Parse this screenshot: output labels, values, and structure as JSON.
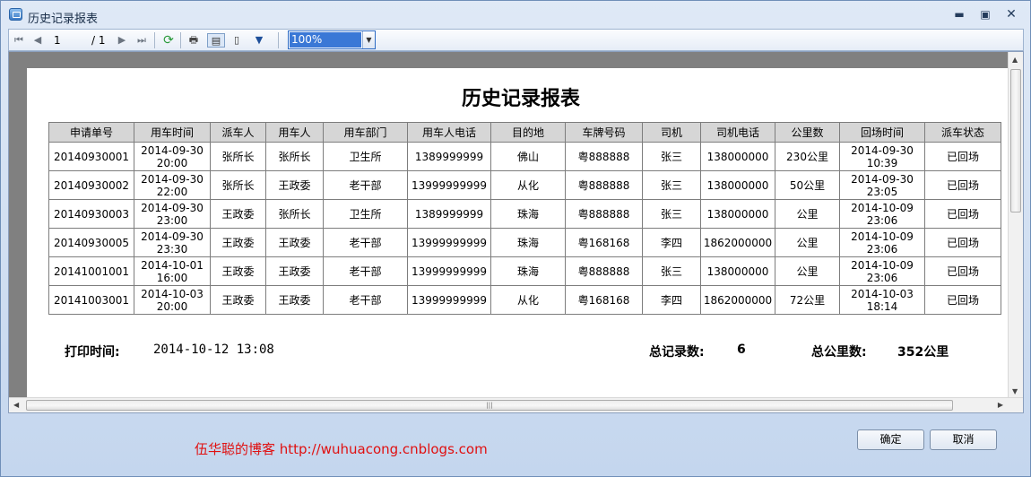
{
  "window": {
    "title": "历史记录报表",
    "minimize": "▬",
    "maximize": "▣",
    "close": "✕"
  },
  "toolbar": {
    "first_icon": "first-page-icon",
    "prev_icon": "prev-page-icon",
    "current_page": "1",
    "total_pages": "/ 1",
    "next_icon": "next-page-icon",
    "last_icon": "last-page-icon",
    "zoom": "100%"
  },
  "report": {
    "title": "历史记录报表",
    "columns": [
      "申请单号",
      "用车时间",
      "派车人",
      "用车人",
      "用车部门",
      "用车人电话",
      "目的地",
      "车牌号码",
      "司机",
      "司机电话",
      "公里数",
      "回场时间",
      "派车状态"
    ],
    "rows": [
      {
        "id": "20140930001",
        "use_time": [
          "2014-09-30",
          "20:00"
        ],
        "dispatcher": "张所长",
        "user": "张所长",
        "dept": "卫生所",
        "user_phone": "1389999999",
        "dest": "佛山",
        "plate": "粤888888",
        "driver": "张三",
        "driver_phone": "138000000",
        "km": "230公里",
        "return_time": [
          "2014-09-30",
          "10:39"
        ],
        "status": "已回场"
      },
      {
        "id": "20140930002",
        "use_time": [
          "2014-09-30",
          "22:00"
        ],
        "dispatcher": "张所长",
        "user": "王政委",
        "dept": "老干部",
        "user_phone": "13999999999",
        "dest": "从化",
        "plate": "粤888888",
        "driver": "张三",
        "driver_phone": "138000000",
        "km": "50公里",
        "return_time": [
          "2014-09-30",
          "23:05"
        ],
        "status": "已回场"
      },
      {
        "id": "20140930003",
        "use_time": [
          "2014-09-30",
          "23:00"
        ],
        "dispatcher": "王政委",
        "user": "张所长",
        "dept": "卫生所",
        "user_phone": "1389999999",
        "dest": "珠海",
        "plate": "粤888888",
        "driver": "张三",
        "driver_phone": "138000000",
        "km": "公里",
        "return_time": [
          "2014-10-09",
          "23:06"
        ],
        "status": "已回场"
      },
      {
        "id": "20140930005",
        "use_time": [
          "2014-09-30",
          "23:30"
        ],
        "dispatcher": "王政委",
        "user": "王政委",
        "dept": "老干部",
        "user_phone": "13999999999",
        "dest": "珠海",
        "plate": "粤168168",
        "driver": "李四",
        "driver_phone": "1862000000",
        "km": "公里",
        "return_time": [
          "2014-10-09",
          "23:06"
        ],
        "status": "已回场"
      },
      {
        "id": "20141001001",
        "use_time": [
          "2014-10-01",
          "16:00"
        ],
        "dispatcher": "王政委",
        "user": "王政委",
        "dept": "老干部",
        "user_phone": "13999999999",
        "dest": "珠海",
        "plate": "粤888888",
        "driver": "张三",
        "driver_phone": "138000000",
        "km": "公里",
        "return_time": [
          "2014-10-09",
          "23:06"
        ],
        "status": "已回场"
      },
      {
        "id": "20141003001",
        "use_time": [
          "2014-10-03",
          "20:00"
        ],
        "dispatcher": "王政委",
        "user": "王政委",
        "dept": "老干部",
        "user_phone": "13999999999",
        "dest": "从化",
        "plate": "粤168168",
        "driver": "李四",
        "driver_phone": "1862000000",
        "km": "72公里",
        "return_time": [
          "2014-10-03",
          "18:14"
        ],
        "status": "已回场"
      }
    ],
    "footer": {
      "print_time_label": "打印时间:",
      "print_time": "2014-10-12 13:08",
      "total_records_label": "总记录数:",
      "total_records": "6",
      "total_km_label": "总公里数:",
      "total_km": "352公里"
    }
  },
  "blog_link": "伍华聪的博客 http://wuhuacong.cnblogs.com",
  "buttons": {
    "ok": "确定",
    "cancel": "取消"
  },
  "colors": {
    "link": "#e01010",
    "zoom_highlight": "#3a78d6"
  }
}
